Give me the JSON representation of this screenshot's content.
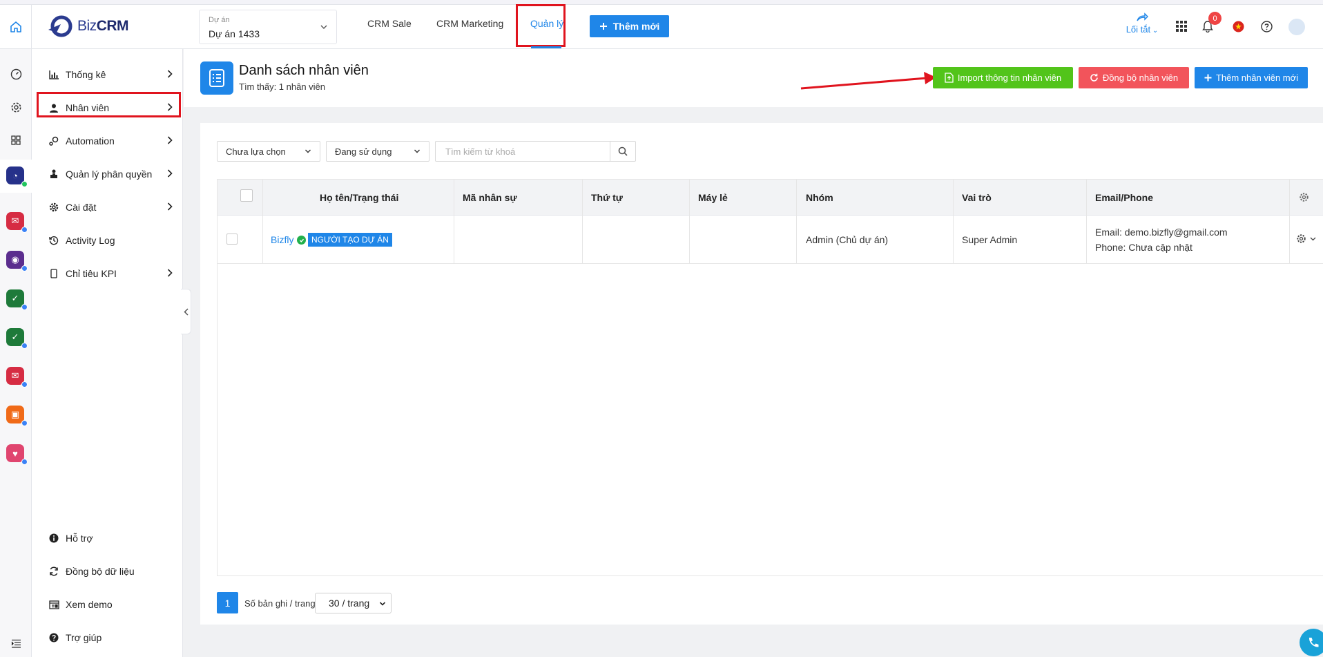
{
  "header": {
    "logo_biz": "Biz",
    "logo_crm": "CRM",
    "project_label": "Dự án",
    "project_value": "Dự án 1433",
    "nav": [
      "CRM Sale",
      "CRM Marketing",
      "Quản lý"
    ],
    "add_button": "Thêm mới",
    "shortcut_label": "Lối tắt",
    "notification_count": "0"
  },
  "sidebar": {
    "items": [
      {
        "label": "Thống kê",
        "icon": "bar-chart-icon"
      },
      {
        "label": "Nhân viên",
        "icon": "user-icon"
      },
      {
        "label": "Automation",
        "icon": "automation-icon"
      },
      {
        "label": "Quản lý phân quyền",
        "icon": "permission-icon"
      },
      {
        "label": "Cài đặt",
        "icon": "gear-icon"
      },
      {
        "label": "Activity Log",
        "icon": "history-icon"
      },
      {
        "label": "Chỉ tiêu KPI",
        "icon": "phone-icon"
      }
    ],
    "bottom": [
      {
        "label": "Hỗ trợ",
        "icon": "info-icon"
      },
      {
        "label": "Đồng bộ dữ liệu",
        "icon": "sync-icon"
      },
      {
        "label": "Xem demo",
        "icon": "demo-icon"
      },
      {
        "label": "Trợ giúp",
        "icon": "help-icon"
      }
    ]
  },
  "page": {
    "title": "Danh sách nhân viên",
    "subtitle": "Tìm thấy: 1 nhân viên",
    "import_button": "Import thông tin nhân viên",
    "sync_button": "Đồng bộ nhân viên",
    "add_button": "Thêm nhân viên mới"
  },
  "filters": {
    "select1": "Chưa lựa chọn",
    "select2": "Đang sử dụng",
    "search_placeholder": "Tìm kiếm từ khoá"
  },
  "table": {
    "columns": [
      "Họ tên/Trạng thái",
      "Mã nhân sự",
      "Thứ tự",
      "Máy lẻ",
      "Nhóm",
      "Vai trò",
      "Email/Phone"
    ],
    "rows": [
      {
        "name": "Bizfly",
        "tag": "NGƯỜI TẠO DỰ ÁN",
        "code": "",
        "order": "",
        "ext": "",
        "group": "Admin (Chủ dự án)",
        "role": "Super Admin",
        "email": "Email: demo.bizfly@gmail.com",
        "phone": "Phone: Chưa cập nhật"
      }
    ]
  },
  "pagination": {
    "current_page": "1",
    "per_page_label": "Số bản ghi / trang",
    "per_page_value": "30 / trang"
  },
  "colors": {
    "primary": "#1f86e8",
    "import_green": "#52c41a",
    "sync_red": "#f2545b",
    "highlight_red": "#e0141e"
  }
}
